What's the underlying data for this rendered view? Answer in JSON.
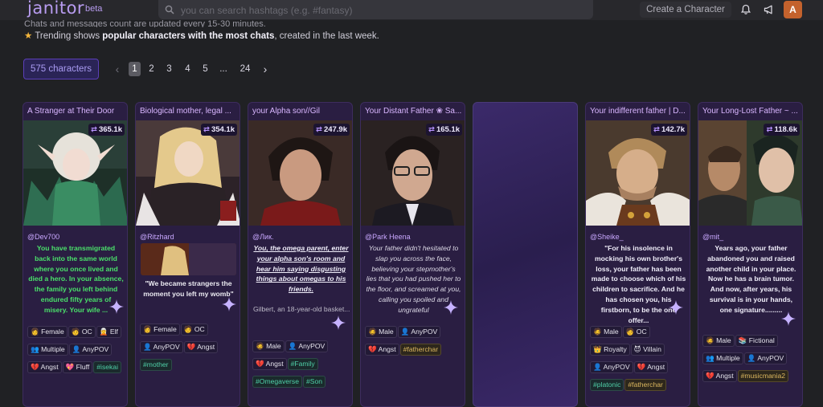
{
  "app": {
    "name": "janitor",
    "badge": "beta"
  },
  "search": {
    "placeholder": "you can search hashtags (e.g. #fantasy)"
  },
  "header": {
    "create_label": "Create a Character",
    "avatar_letter": "A"
  },
  "info": {
    "line1": "Chats and messages count are updated every 15-30 minutes.",
    "line2_pre": "Trending shows ",
    "line2_bold": "popular characters with the most chats",
    "line2_post": ", created in the last week."
  },
  "pagination": {
    "count_label": "575 characters",
    "pages": [
      "1",
      "2",
      "3",
      "4",
      "5",
      "...",
      "24"
    ],
    "current": "1"
  },
  "cards": [
    {
      "title": "A Stranger at Their Door",
      "chats": "365.1k",
      "author": "@Dev700",
      "description": "You have transmigrated back into the same world where you once lived and died a hero. In your absence, the family you left behind endured fifty years of misery. Your wife ...",
      "tags": [
        "👩 Female",
        "🧑 OC",
        "🧝 Elf",
        "👥 Multiple",
        "👤 AnyPOV",
        "💔 Angst",
        "💖 Fluff",
        "#isekai"
      ]
    },
    {
      "title": "Biological mother, legal ...",
      "chats": "354.1k",
      "author": "@Ritzhard",
      "description": "\"We became strangers the moment you left my womb\"",
      "tags": [
        "👩 Female",
        "🧑 OC",
        "👤 AnyPOV",
        "💔 Angst",
        "#mother"
      ]
    },
    {
      "title": "your Alpha son//Gil",
      "chats": "247.9k",
      "author": "@Лик.",
      "description": "You, the omega parent, enter your alpha son's room and hear him saying disgusting things about omegas to his friends.",
      "extra": "Gilbert, an 18-year-old basket...",
      "tags": [
        "🧔 Male",
        "👤 AnyPOV",
        "💔 Angst",
        "#Family",
        "#Omegaverse",
        "#Son"
      ]
    },
    {
      "title": "Your Distant Father ❀ Sa...",
      "chats": "165.1k",
      "author": "@Park Heena",
      "description": "Your father didn't hesitated to slap you across the face, believing your stepmother's lies that you had pushed her to the floor, and screamed at you, calling you spoiled and ungrateful",
      "tags": [
        "🧔 Male",
        "👤 AnyPOV",
        "💔 Angst",
        "#fatherchar"
      ]
    },
    {
      "title": "Your indifferent father | D...",
      "chats": "142.7k",
      "author": "@Sheike_",
      "description": "\"For his insolence in mocking his own brother's loss, your father has been made to choose which of his children to sacrifice. And he has chosen you, his firstborn, to be the one offer...",
      "tags": [
        "🧔 Male",
        "🧑 OC",
        "👑 Royalty",
        "😈 Villain",
        "👤 AnyPOV",
        "💔 Angst",
        "#platonic",
        "#fatherchar"
      ]
    },
    {
      "title": "Your Long-Lost Father ~ ...",
      "chats": "118.6k",
      "author": "@mit_",
      "description": "Years ago, your father abandoned you and raised another child in your place. Now he has a brain tumor. And now, after years, his survival is in your hands, one signature.........",
      "tags": [
        "🧔 Male",
        "📚 Fictional",
        "👥 Multiple",
        "👤 AnyPOV",
        "💔 Angst",
        "#musicmania2"
      ]
    }
  ],
  "colors": {
    "accent": "#b89cf0",
    "card_bg": "#2a1e42",
    "hashtag": "#4fd0a8",
    "hashtag_gold": "#ddb85f",
    "badge_border": "#5b3fb8"
  }
}
